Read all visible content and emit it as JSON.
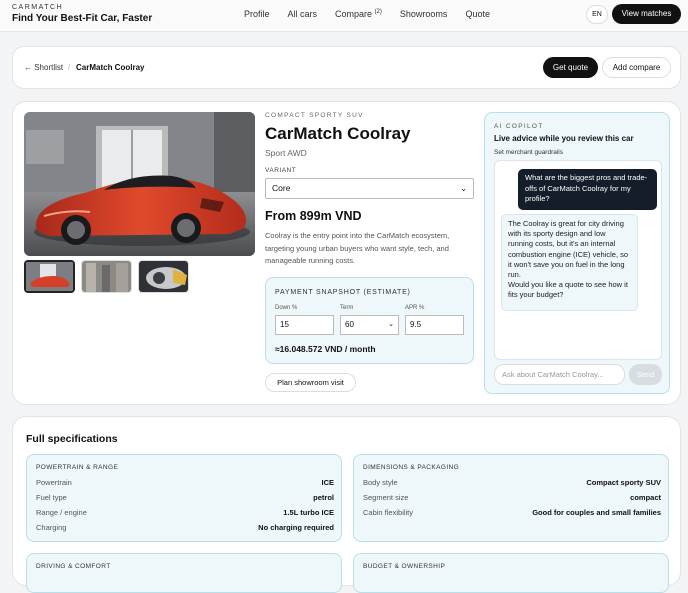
{
  "brand": {
    "small": "CARMATCH",
    "tagline": "Find Your Best-Fit Car, Faster"
  },
  "nav": {
    "profile": "Profile",
    "all_cars": "All cars",
    "compare": "Compare",
    "compare_count": "(2)",
    "showrooms": "Showrooms",
    "quote": "Quote"
  },
  "header": {
    "lang": "EN",
    "view_matches": "View matches"
  },
  "breadcrumb": {
    "back": "← Shortlist",
    "separator": "/",
    "current": "CarMatch Coolray",
    "get_quote": "Get quote",
    "add_compare": "Add compare"
  },
  "car": {
    "kicker": "COMPACT SPORTY SUV",
    "name": "CarMatch Coolray",
    "subtitle": "Sport AWD",
    "variant_label": "VARIANT",
    "variant_value": "Core",
    "price": "From 899m VND",
    "description": "Coolray is the entry point into the CarMatch ecosystem, targeting young urban buyers who want style, tech, and manageable running costs."
  },
  "payment": {
    "title": "PAYMENT SNAPSHOT (ESTIMATE)",
    "down_label": "Down %",
    "down_value": "15",
    "term_label": "Term",
    "term_value": "60",
    "apr_label": "APR %",
    "apr_value": "9.5",
    "monthly": "≈16.048.572 VND / month"
  },
  "plan_visit": "Plan showroom visit",
  "copilot": {
    "kicker": "AI COPILOT",
    "title": "Live advice while you review this car",
    "guardrails": "Set merchant guardrails",
    "user_msg": "What are the biggest pros and trade-offs of CarMatch Coolray for my profile?",
    "bot_msg_1": "The Coolray is great for city driving with its sporty design and low running costs, but it's an internal combustion engine (ICE) vehicle, so it won't save you on fuel in the long run.",
    "bot_msg_2": "Would you like a quote to see how it fits your budget?",
    "input_placeholder": "Ask about CarMatch Coolray...",
    "send": "Send"
  },
  "specs": {
    "title": "Full specifications",
    "powertrain": {
      "title": "POWERTRAIN & RANGE",
      "rows": [
        {
          "k": "Powertrain",
          "v": "ICE"
        },
        {
          "k": "Fuel type",
          "v": "petrol"
        },
        {
          "k": "Range / engine",
          "v": "1.5L turbo ICE"
        },
        {
          "k": "Charging",
          "v": "No charging required"
        }
      ]
    },
    "dimensions": {
      "title": "DIMENSIONS & PACKAGING",
      "rows": [
        {
          "k": "Body style",
          "v": "Compact sporty SUV"
        },
        {
          "k": "Segment size",
          "v": "compact"
        },
        {
          "k": "Cabin flexibility",
          "v": "Good for couples and small families"
        }
      ]
    },
    "driving": {
      "title": "DRIVING & COMFORT"
    },
    "budget": {
      "title": "BUDGET & OWNERSHIP"
    }
  },
  "colors": {
    "accent_bg": "#eef7f9",
    "accent_border": "#b9e0ea",
    "dark": "#111111",
    "car_red": "#c8341f"
  },
  "icons": {
    "select_chevron": "chevron-down-icon",
    "back_arrow": "arrow-left-icon"
  }
}
